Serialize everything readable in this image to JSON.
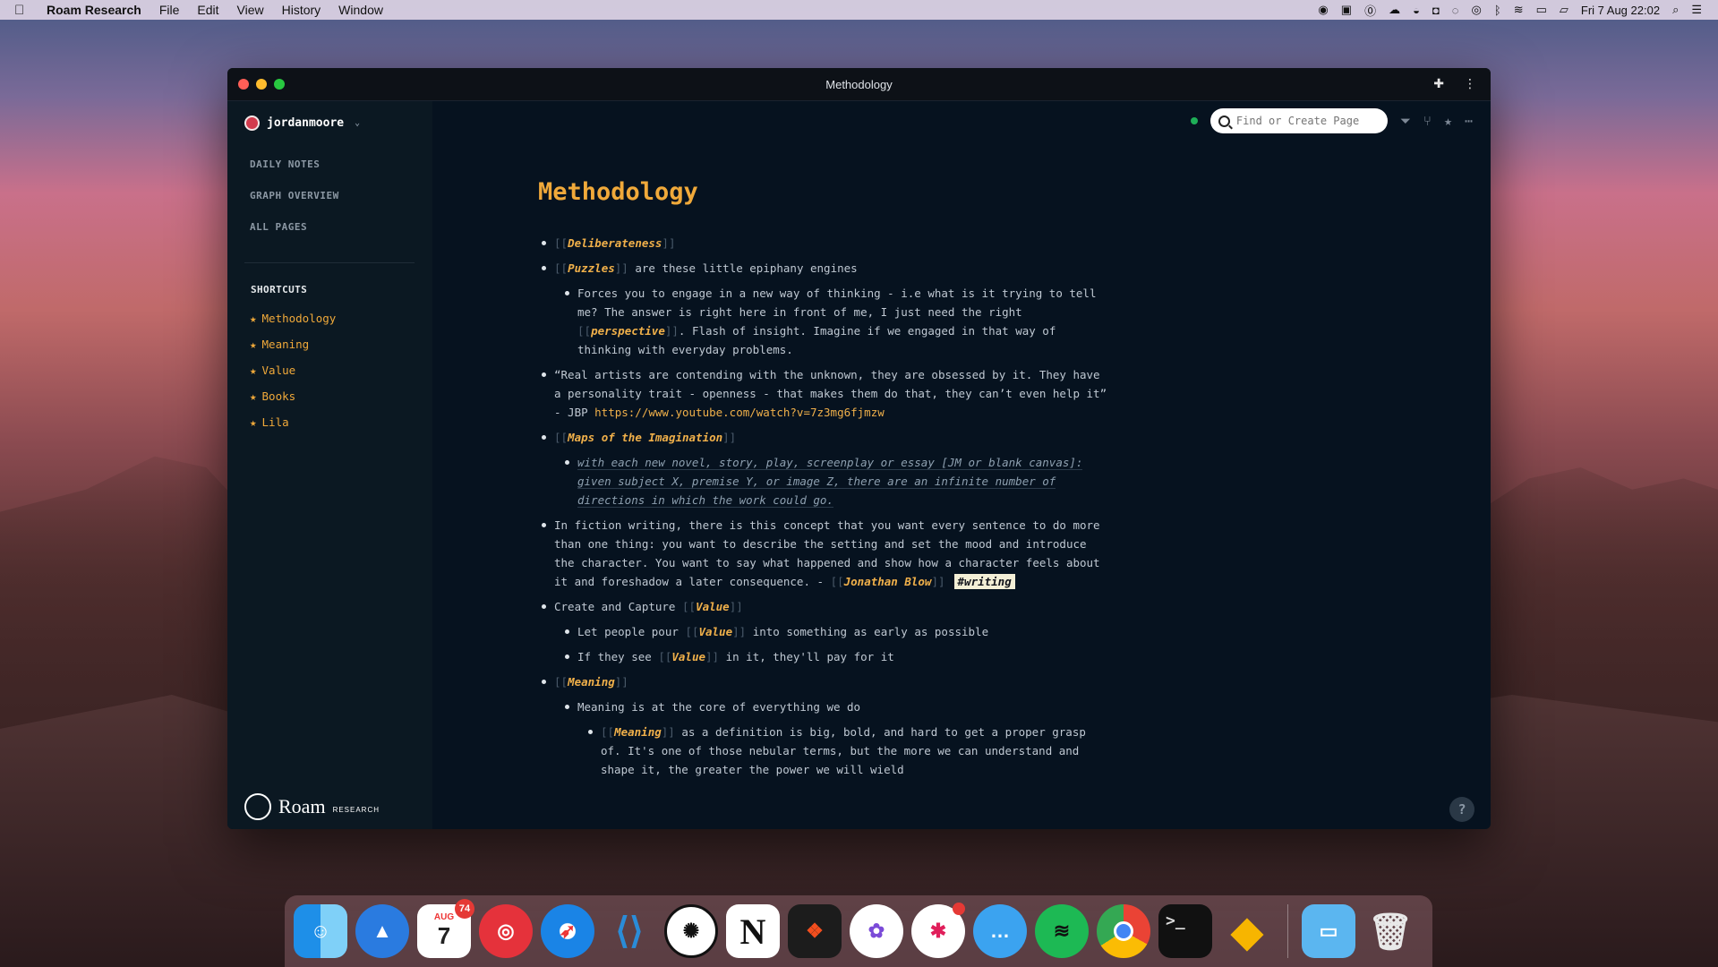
{
  "menubar": {
    "app_name": "Roam Research",
    "menus": [
      "File",
      "Edit",
      "View",
      "History",
      "Window"
    ],
    "clock": "Fri 7 Aug  22:02"
  },
  "window": {
    "title": "Methodology"
  },
  "sidebar": {
    "user": "jordanmoore",
    "nav": [
      "DAILY NOTES",
      "GRAPH OVERVIEW",
      "ALL PAGES"
    ],
    "shortcuts_heading": "SHORTCUTS",
    "shortcuts": [
      "Methodology",
      "Meaning",
      "Value",
      "Books",
      "Lila"
    ],
    "logo_word": "Roam",
    "logo_sub": "RESEARCH"
  },
  "search": {
    "placeholder": "Find or Create Page"
  },
  "page": {
    "title": "Methodology",
    "b1_link": "Deliberateness",
    "b2_link": "Puzzles",
    "b2_text": " are these little epiphany engines",
    "b2a_text1": "Forces you to engage in a new way of thinking - i.e what is it trying to tell me? The answer is right here in front of me, I just need the right ",
    "b2a_link": "perspective",
    "b2a_text2": ". Flash of insight. Imagine if we engaged in that way of thinking with everyday problems.",
    "b3_text": "“Real artists are contending with the unknown, they are obsessed by it. They have a personality trait - openness - that makes them do that, they can’t even help it” - JBP ",
    "b3_url": "https://www.youtube.com/watch?v=7z3mg6fjmzw",
    "b4_link": "Maps of the Imagination",
    "b4a_quote": "with each new novel, story, play, screenplay or essay [JM or blank canvas]: given subject X, premise Y, or image Z, there are an infinite number of directions in which the work could go.",
    "b5_text": "In fiction writing, there is this concept that you want every sentence to do more than one thing: you want to describe the setting and set the mood and introduce the character. You want to say what happened and show how a character feels about it and foreshadow a later consequence. - ",
    "b5_link": "Jonathan Blow",
    "b5_tag": "#writing",
    "b6_text": "Create and Capture ",
    "b6_link": "Value",
    "b6a_text1": "Let people pour ",
    "b6a_link": "Value",
    "b6a_text2": " into something as early as possible",
    "b6b_text1": "If they see ",
    "b6b_link": "Value",
    "b6b_text2": " in it, they'll pay for it",
    "b7_link": "Meaning",
    "b7a_text": "Meaning is at the core of everything we do",
    "b7b_link": "Meaning",
    "b7b_text": " as a definition is big, bold, and hard to get a proper grasp of. It's one of those nebular terms, but the more we can understand and shape it, the greater the power we will wield"
  },
  "dock": {
    "calendar_month": "AUG",
    "calendar_day": "7",
    "calendar_badge": "74",
    "terminal_prompt": ">_"
  }
}
